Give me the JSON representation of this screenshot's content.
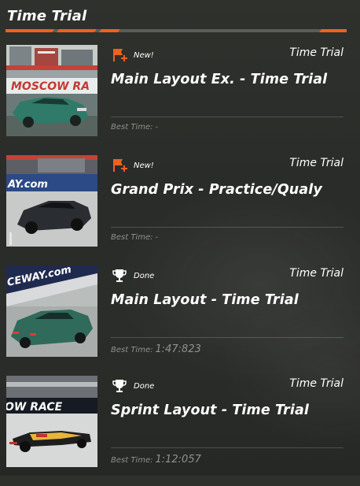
{
  "header": {
    "title": "Time Trial",
    "accent_color": "#f0611e"
  },
  "events": [
    {
      "status_icon": "new-flag-icon",
      "status": "New!",
      "type": "Time Trial",
      "name": "Main Layout Ex. - Time Trial",
      "best_label": "Best Time:",
      "best_time": "-",
      "thumbnail": "moscow-raceway-green-sedan",
      "thumbnail_text": "MOSCOW RA"
    },
    {
      "status_icon": "new-flag-icon",
      "status": "New!",
      "type": "Time Trial",
      "name": "Grand Prix - Practice/Qualy",
      "best_label": "Best Time:",
      "best_time": "-",
      "thumbnail": "dark-gt-car",
      "thumbnail_text": "AY.com"
    },
    {
      "status_icon": "trophy-icon",
      "status": "Done",
      "type": "Time Trial",
      "name": "Main Layout - Time Trial",
      "best_label": "Best Time:",
      "best_time": "1:47:823",
      "thumbnail": "green-hypercar",
      "thumbnail_text": "CEWAY.com"
    },
    {
      "status_icon": "trophy-icon",
      "status": "Done",
      "type": "Time Trial",
      "name": "Sprint Layout - Time Trial",
      "best_label": "Best Time:",
      "best_time": "1:12:057",
      "thumbnail": "formula-car",
      "thumbnail_text": "OW RACE"
    }
  ]
}
